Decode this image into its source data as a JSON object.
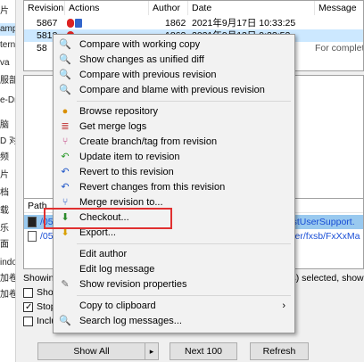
{
  "left_strip": {
    "items": [
      "片",
      "amp",
      "tern",
      "va",
      "服部",
      "e-Dri",
      "脑",
      "D 对",
      "频",
      "片",
      "档",
      "载",
      "乐",
      "面",
      "indo",
      "加卷",
      "加卷"
    ]
  },
  "log_table": {
    "headers": [
      "Revision",
      "Actions",
      "Author",
      "Date",
      "Message"
    ],
    "rows": [
      {
        "revision": "5867",
        "author": "1862",
        "date": "2021年9月17日 10:33:25",
        "message": ""
      },
      {
        "revision": "5818",
        "author": "1862",
        "date": "2021年9月13日 9:22:52",
        "message": ""
      },
      {
        "revision": "58",
        "author": "",
        "date": "",
        "message": "For complete"
      }
    ]
  },
  "path_panel": {
    "header": "Path",
    "rows": [
      {
        "prefix": "/05",
        "suffix": "ll/VstUserSupport."
      },
      {
        "prefix": "/05",
        "suffix": "apper/fxsb/FxXxMa"
      }
    ]
  },
  "options": {
    "showing": "Showing",
    "show": "Show",
    "stop": "Stop",
    "include": "Inclu",
    "status": "(s) selected, show"
  },
  "buttons": {
    "show_all": "Show All",
    "arrow": "▸",
    "next": "Next 100",
    "refresh": "Refresh"
  },
  "context_menu": {
    "items": [
      {
        "label": "Compare with working copy",
        "icon": "magnifier-icon"
      },
      {
        "label": "Show changes as unified diff",
        "icon": "magnifier-icon"
      },
      {
        "label": "Compare with previous revision",
        "icon": "magnifier-icon"
      },
      {
        "label": "Compare and blame with previous revision",
        "icon": "compare-blame-icon"
      },
      {
        "label": "Browse repository",
        "icon": "repo-browser-icon"
      },
      {
        "label": "Get merge logs",
        "icon": "merge-logs-icon"
      },
      {
        "label": "Create branch/tag from revision",
        "icon": "branch-icon"
      },
      {
        "label": "Update item to revision",
        "icon": "update-icon"
      },
      {
        "label": "Revert to this revision",
        "icon": "revert-icon"
      },
      {
        "label": "Revert changes from this revision",
        "icon": "revert-changes-icon"
      },
      {
        "label": "Merge revision to...",
        "icon": "merge-icon"
      },
      {
        "label": "Checkout...",
        "icon": "checkout-icon"
      },
      {
        "label": "Export...",
        "icon": "export-icon"
      },
      {
        "label": "Edit author",
        "icon": ""
      },
      {
        "label": "Edit log message",
        "icon": ""
      },
      {
        "label": "Show revision properties",
        "icon": "properties-icon"
      },
      {
        "label": "Copy to clipboard",
        "icon": "",
        "submenu": "›"
      },
      {
        "label": "Search log messages...",
        "icon": "search-icon"
      }
    ]
  },
  "colors": {
    "selection": "#cce8ff",
    "highlight_box": "#e03030",
    "link_blue": "#1a4fd6"
  }
}
